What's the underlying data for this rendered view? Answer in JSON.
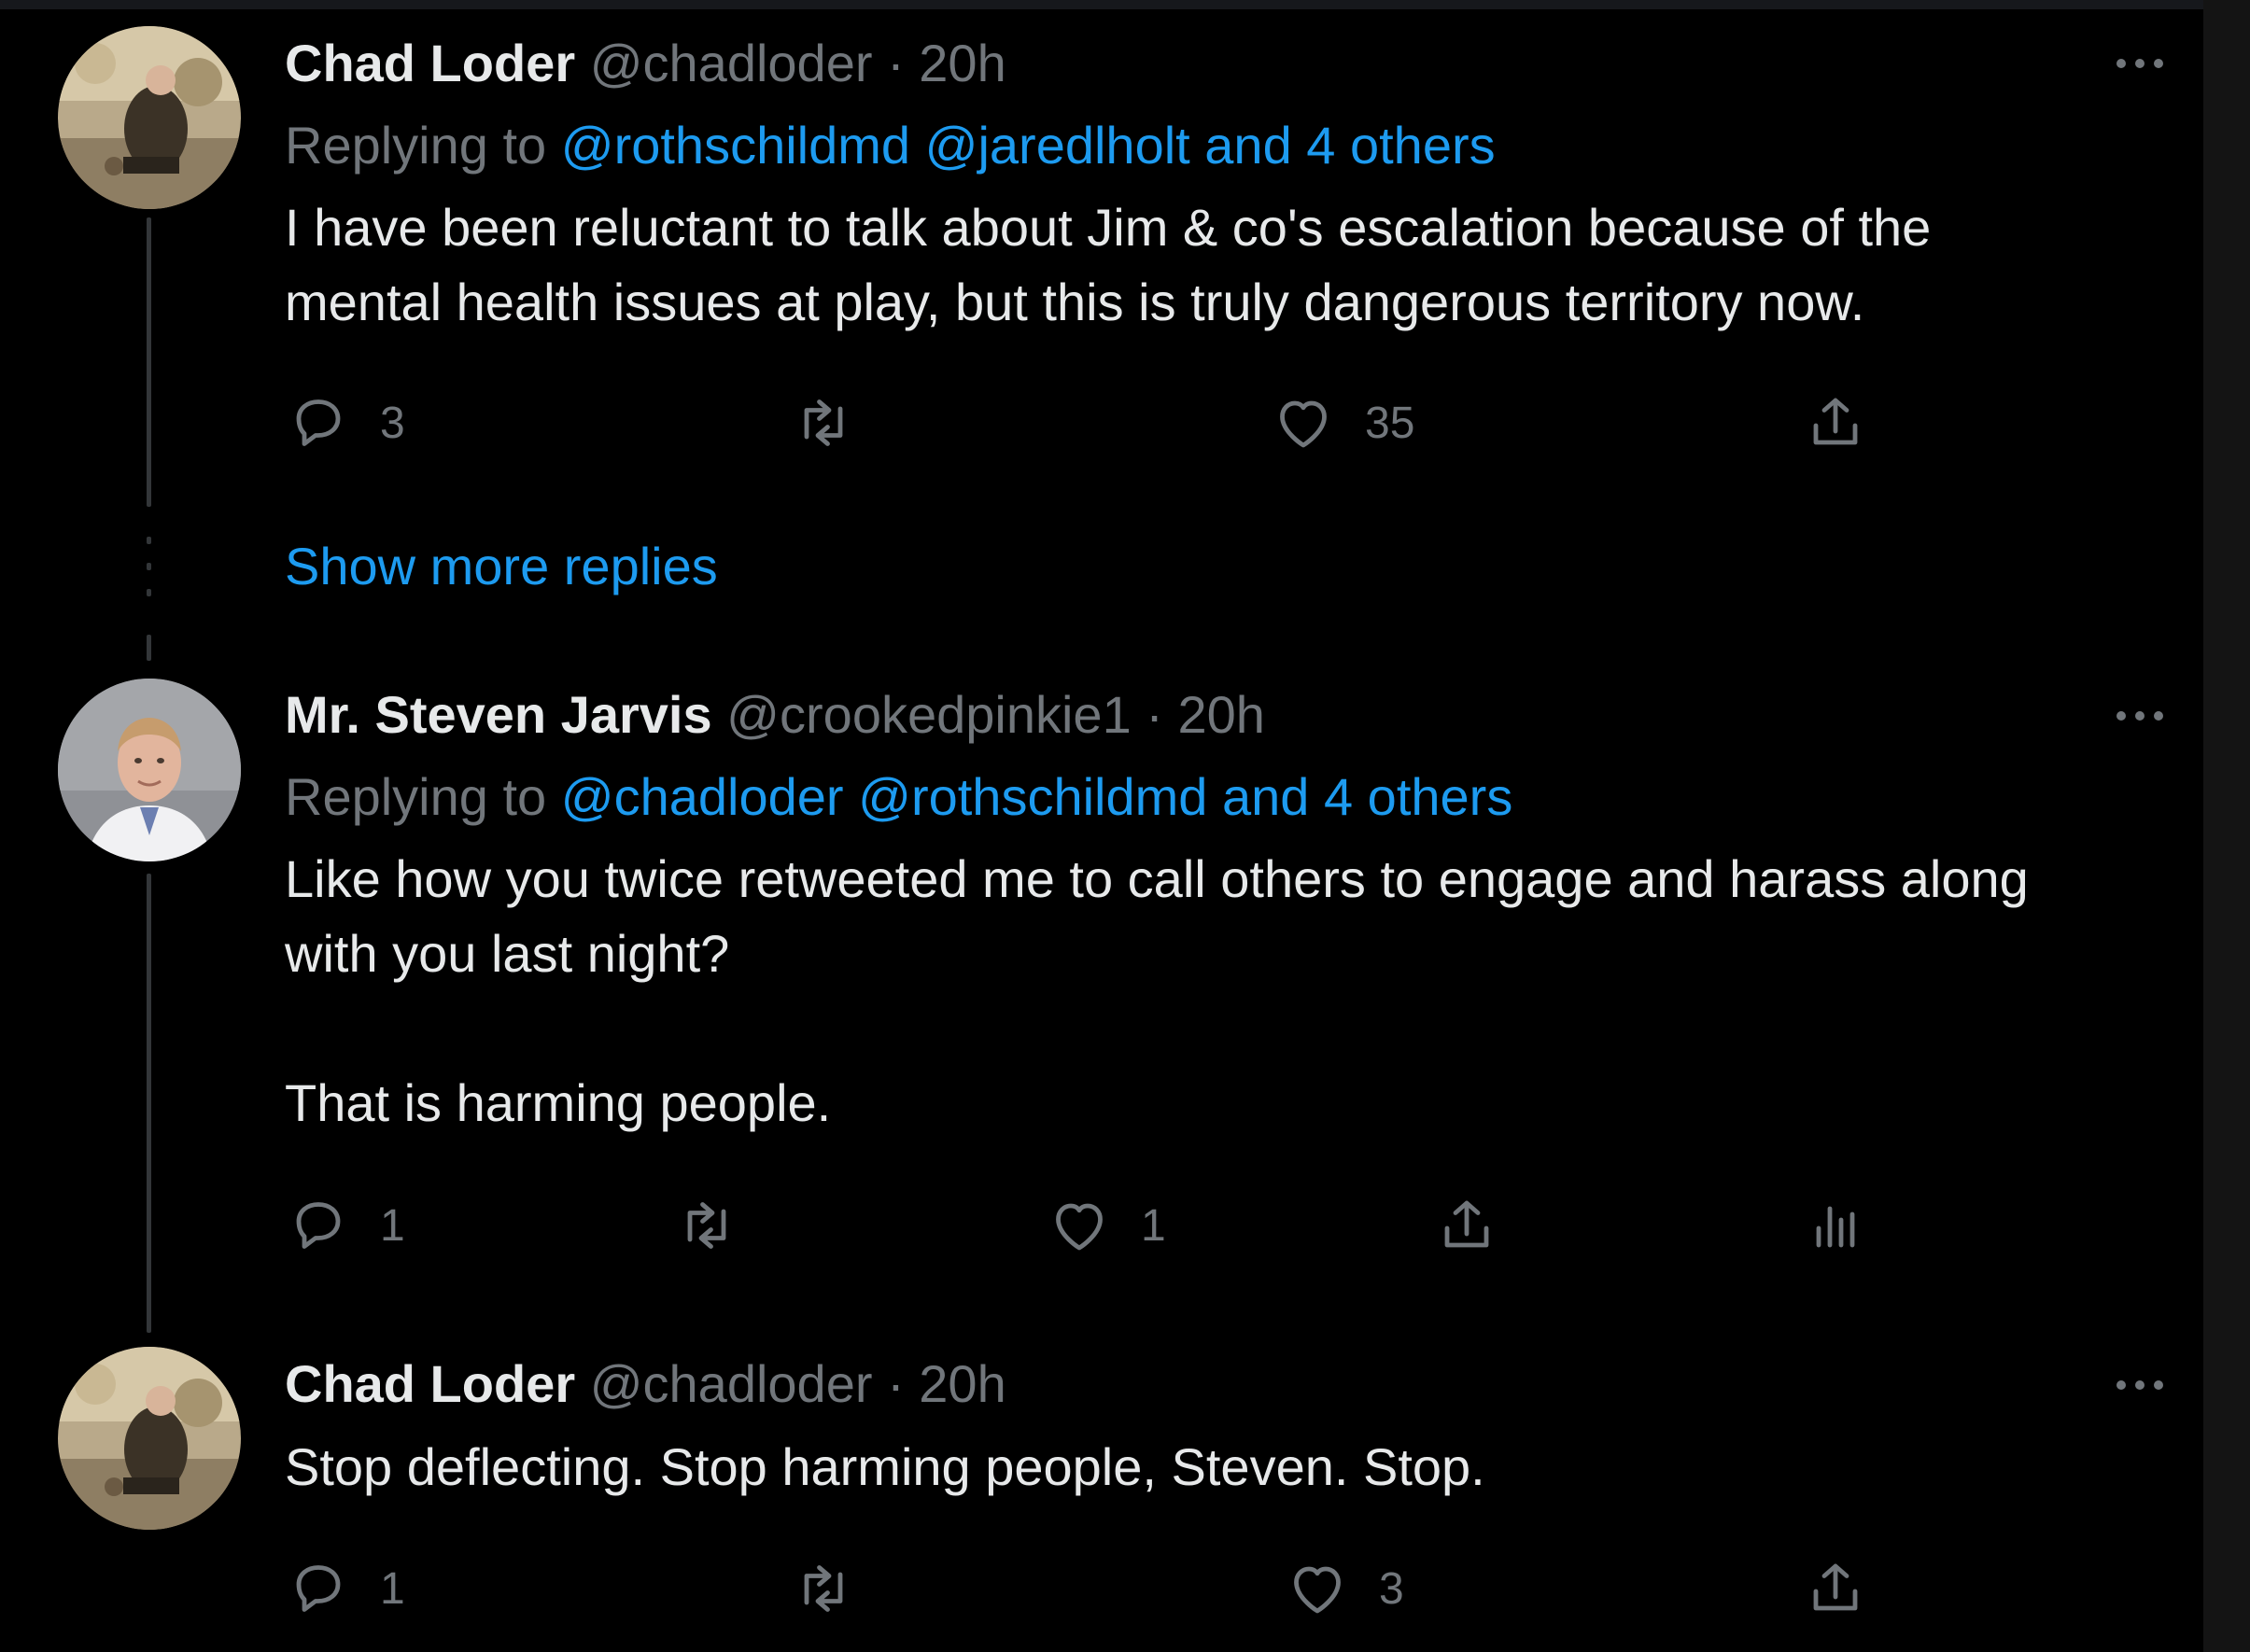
{
  "tweets": [
    {
      "name": "Chad Loder",
      "handle": "@chadloder",
      "separator": "·",
      "time": "20h",
      "replying_label": "Replying to",
      "mentions": [
        "@rothschildmd",
        "@jaredlholt",
        "and 4 others"
      ],
      "text": "I have been reluctant to talk about Jim & co's escalation because of the\nmental health issues at play, but this is truly dangerous territory now.",
      "replies": "3",
      "likes": "35"
    },
    {
      "name": "Mr. Steven Jarvis",
      "handle": "@crookedpinkie1",
      "separator": "·",
      "time": "20h",
      "replying_label": "Replying to",
      "mentions": [
        "@chadloder",
        "@rothschildmd",
        "and 4 others"
      ],
      "text": "Like how you twice retweeted me to call others to engage and harass along\nwith you last night?\n\nThat is harming people.",
      "replies": "1",
      "likes": "1"
    },
    {
      "name": "Chad Loder",
      "handle": "@chadloder",
      "separator": "·",
      "time": "20h",
      "text": "Stop deflecting. Stop harming people, Steven. Stop.",
      "replies": "1",
      "likes": "3"
    }
  ],
  "show_more_replies": "Show more replies",
  "icons": {
    "reply": "reply-icon",
    "retweet": "retweet-icon",
    "like": "heart-icon",
    "share": "share-icon",
    "analytics": "analytics-icon",
    "more": "more-icon"
  },
  "colors": {
    "background": "#000000",
    "text": "#e7e9ea",
    "secondary": "#71767b",
    "link": "#1d9bf0",
    "thread_line": "#333639"
  }
}
